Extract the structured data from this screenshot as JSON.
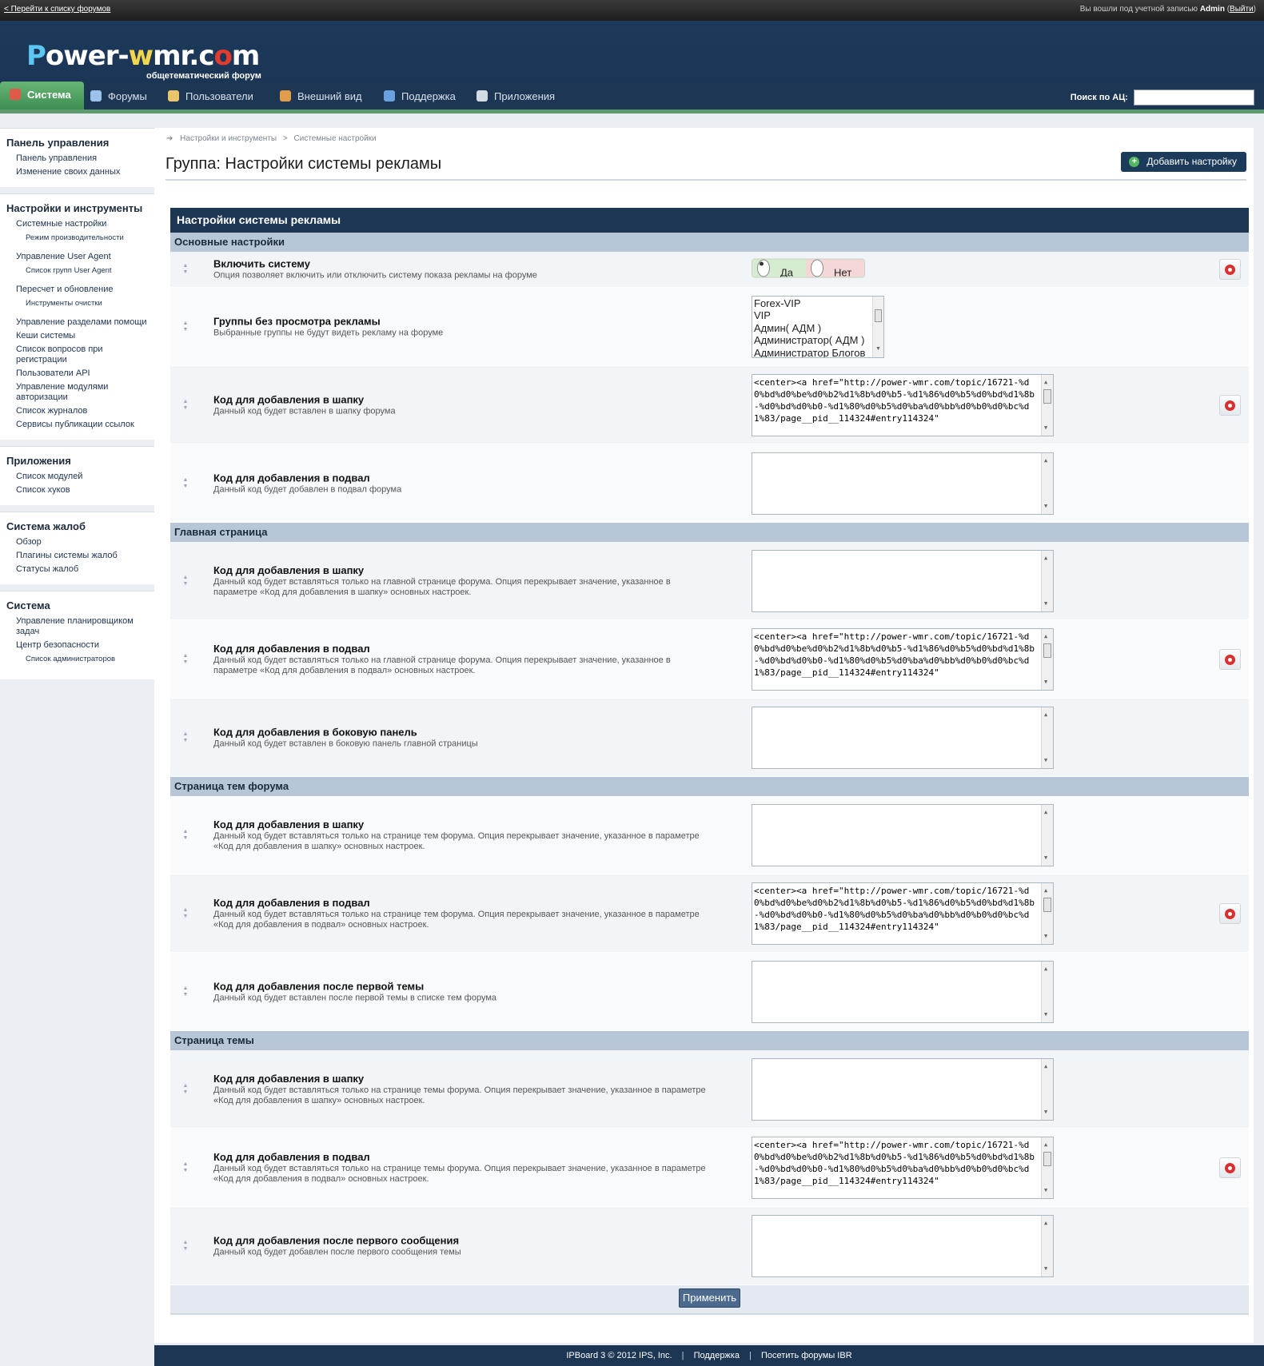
{
  "topbar": {
    "back_link": "< Перейти к списку форумов",
    "logged_in_prefix": "Вы вошли под учетной записью",
    "username": "Admin",
    "logout_label": "Выйти"
  },
  "logo": {
    "letter_p": "P",
    "part_ower": "ower-",
    "letter_w": "w",
    "part_mr_c": "mr.c",
    "letter_o": "o",
    "letter_m": "m",
    "tagline": "общетематический форум"
  },
  "nav": {
    "tabs": [
      {
        "label": "Система",
        "icon": "system-icon",
        "color": "#e05a4a"
      },
      {
        "label": "Форумы",
        "icon": "forums-icon",
        "color": "#9cc3e8"
      },
      {
        "label": "Пользователи",
        "icon": "users-icon",
        "color": "#e9c46a"
      },
      {
        "label": "Внешний вид",
        "icon": "palette-icon",
        "color": "#e39c4a"
      },
      {
        "label": "Поддержка",
        "icon": "support-icon",
        "color": "#6aa2de"
      },
      {
        "label": "Приложения",
        "icon": "apps-icon",
        "color": "#d5dbe2"
      }
    ],
    "search_label": "Поиск по АЦ:",
    "search_value": ""
  },
  "sidebar": {
    "sections": [
      {
        "title": "Панель управления",
        "items": [
          {
            "label": "Панель управления",
            "sub": []
          },
          {
            "label": "Изменение своих данных",
            "sub": []
          }
        ]
      },
      {
        "title": "Настройки и инструменты",
        "items": [
          {
            "label": "Системные настройки",
            "sub": [
              "Режим производительности"
            ]
          },
          {
            "label": "Управление User Agent",
            "sub": [
              "Список групп User Agent"
            ]
          },
          {
            "label": "Пересчет и обновление",
            "sub": [
              "Инструменты очистки"
            ]
          },
          {
            "label": "Управление разделами помощи",
            "sub": []
          },
          {
            "label": "Кеши системы",
            "sub": []
          },
          {
            "label": "Список вопросов при регистрации",
            "sub": []
          },
          {
            "label": "Пользователи API",
            "sub": []
          },
          {
            "label": "Управление модулями авторизации",
            "sub": []
          },
          {
            "label": "Список журналов",
            "sub": []
          },
          {
            "label": "Сервисы публикации ссылок",
            "sub": []
          }
        ]
      },
      {
        "title": "Приложения",
        "items": [
          {
            "label": "Список модулей",
            "sub": []
          },
          {
            "label": "Список хуков",
            "sub": []
          }
        ]
      },
      {
        "title": "Система жалоб",
        "items": [
          {
            "label": "Обзор",
            "sub": []
          },
          {
            "label": "Плагины системы жалоб",
            "sub": []
          },
          {
            "label": "Статусы жалоб",
            "sub": []
          }
        ]
      },
      {
        "title": "Система",
        "items": [
          {
            "label": "Управление планировщиком задач",
            "sub": []
          },
          {
            "label": "Центр безопасности",
            "sub": [
              "Список администраторов"
            ]
          }
        ]
      }
    ]
  },
  "main": {
    "breadcrumb": [
      "Настройки и инструменты",
      "Системные настройки"
    ],
    "breadcrumb_sep": ">",
    "title": "Группа: Настройки системы рекламы",
    "add_button": "Добавить настройку",
    "panel_title": "Настройки системы рекламы",
    "apply_button": "Применить",
    "code_value": "<center><a href=\"http://power-wmr.com/topic/16721-%d0%bd%d0%be%d0%b2%d1%8b%d0%b5-%d1%86%d0%b5%d0%bd%d1%8b-%d0%bd%d0%b0-%d1%80%d0%b5%d0%ba%d0%bb%d0%b0%d0%bc%d1%83/page__pid__114324#entry114324\"",
    "groups": [
      {
        "title": "Основные настройки",
        "rows": [
          {
            "name": "Включить систему",
            "desc": "Опция позволяет включить или отключить систему показа рекламы на форуме",
            "type": "yesno",
            "yes": "Да",
            "no": "Нет",
            "value": "yes",
            "revert": true
          },
          {
            "name": "Группы без просмотра рекламы",
            "desc": "Выбранные группы не будут видеть рекламу на форуме",
            "type": "multiselect",
            "options": [
              "Forex-VIP",
              "VIP",
              "Админ( АДМ )",
              "Администратор( АДМ )",
              "Администратор Блогов"
            ],
            "revert": false
          },
          {
            "name": "Код для добавления в шапку",
            "desc": "Данный код будет вставлен в шапку форума",
            "type": "textarea",
            "filled": true,
            "revert": true
          },
          {
            "name": "Код для добавления в подвал",
            "desc": "Данный код будет добавлен в подвал форума",
            "type": "textarea",
            "filled": false,
            "revert": false
          }
        ]
      },
      {
        "title": "Главная страница",
        "rows": [
          {
            "name": "Код для добавления в шапку",
            "desc": "Данный код будет вставляться только на главной странице форума. Опция перекрывает значение, указанное в параметре «Код для добавления в шапку» основных настроек.",
            "type": "textarea",
            "filled": false,
            "revert": false
          },
          {
            "name": "Код для добавления в подвал",
            "desc": "Данный код будет вставляться только на главной странице форума. Опция перекрывает значение, указанное в параметре «Код для добавления в подвал» основных настроек.",
            "type": "textarea",
            "filled": true,
            "revert": true
          },
          {
            "name": "Код для добавления в боковую панель",
            "desc": "Данный код будет вставлен в боковую панель главной страницы",
            "type": "textarea",
            "filled": false,
            "revert": false
          }
        ]
      },
      {
        "title": "Страница тем форума",
        "rows": [
          {
            "name": "Код для добавления в шапку",
            "desc": "Данный код будет вставляться только на странице тем форума. Опция перекрывает значение, указанное в параметре «Код для добавления в шапку» основных настроек.",
            "type": "textarea",
            "filled": false,
            "revert": false
          },
          {
            "name": "Код для добавления в подвал",
            "desc": "Данный код будет вставляться только на странице тем форума. Опция перекрывает значение, указанное в параметре «Код для добавления в подвал» основных настроек.",
            "type": "textarea",
            "filled": true,
            "revert": true
          },
          {
            "name": "Код для добавления после первой темы",
            "desc": "Данный код будет вставлен после первой темы в списке тем форума",
            "type": "textarea",
            "filled": false,
            "revert": false
          }
        ]
      },
      {
        "title": "Страница темы",
        "rows": [
          {
            "name": "Код для добавления в шапку",
            "desc": "Данный код будет вставляться только на странице темы форума. Опция перекрывает значение, указанное в параметре «Код для добавления в шапку» основных настроек.",
            "type": "textarea",
            "filled": false,
            "revert": false
          },
          {
            "name": "Код для добавления в подвал",
            "desc": "Данный код будет вставляться только на странице темы форума. Опция перекрывает значение, указанное в параметре «Код для добавления в подвал» основных настроек.",
            "type": "textarea",
            "filled": true,
            "revert": true
          },
          {
            "name": "Код для добавления после первого сообщения",
            "desc": "Данный код будет добавлен после первого сообщения темы",
            "type": "textarea",
            "filled": false,
            "revert": false
          }
        ]
      }
    ]
  },
  "footer": {
    "copyright": "IPBoard 3 © 2012 IPS, Inc.",
    "support": "Поддержка",
    "visit": "Посетить форумы IBR",
    "sep": "|"
  }
}
